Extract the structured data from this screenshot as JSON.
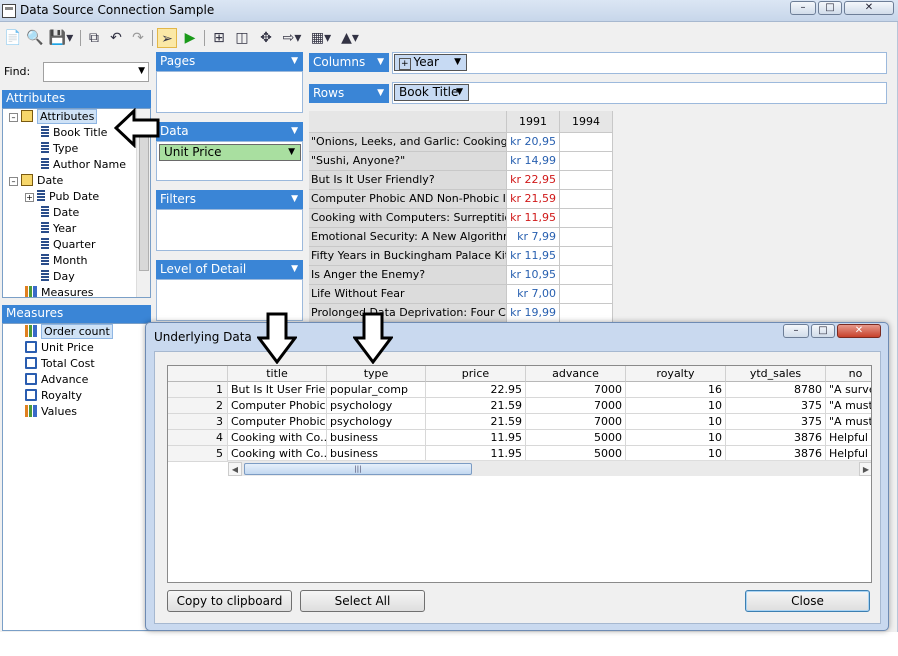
{
  "window": {
    "title": "Data Source Connection Sample",
    "controls": {
      "minimize": "–",
      "maximize": "□",
      "close": "✕"
    }
  },
  "toolbar": {
    "icons": [
      "new-icon",
      "preview-icon",
      "save-icon",
      "copy-icon",
      "undo-icon",
      "redo-icon",
      "pivot-icon",
      "run-icon",
      "table-icon",
      "column-icon",
      "move-icon",
      "export-icon",
      "layout-icon",
      "chart-icon"
    ]
  },
  "find": {
    "label": "Find:",
    "value": ""
  },
  "attributes_panel": {
    "header": "Attributes",
    "items": [
      {
        "label": "Attributes",
        "icon": "folder"
      },
      {
        "label": "Book Title",
        "icon": "attribute"
      },
      {
        "label": "Type",
        "icon": "attribute"
      },
      {
        "label": "Author Name",
        "icon": "attribute"
      },
      {
        "label": "Date",
        "icon": "folder"
      },
      {
        "label": "Pub Date",
        "icon": "hierarchy"
      },
      {
        "label": "Date",
        "icon": "attribute"
      },
      {
        "label": "Year",
        "icon": "attribute"
      },
      {
        "label": "Quarter",
        "icon": "attribute"
      },
      {
        "label": "Month",
        "icon": "attribute"
      },
      {
        "label": "Day",
        "icon": "attribute"
      },
      {
        "label": "Measures",
        "icon": "measure-group"
      }
    ]
  },
  "measures_panel": {
    "header": "Measures",
    "items": [
      {
        "label": "Order count",
        "icon": "measure-group"
      },
      {
        "label": "Unit Price",
        "icon": "measure"
      },
      {
        "label": "Total Cost",
        "icon": "measure"
      },
      {
        "label": "Advance",
        "icon": "measure"
      },
      {
        "label": "Royalty",
        "icon": "measure"
      },
      {
        "label": "Values",
        "icon": "measure-group"
      }
    ]
  },
  "shelves": {
    "pages": "Pages",
    "data": "Data",
    "data_field": "Unit Price",
    "filters": "Filters",
    "level_of_detail": "Level of Detail",
    "columns": "Columns",
    "columns_field": "Year",
    "rows": "Rows",
    "rows_field": "Book Title"
  },
  "pivot": {
    "columns": [
      "1991",
      "1994"
    ],
    "rows": [
      {
        "title": "\"Onions, Leeks, and Garlic: Cooking...",
        "v1991": "kr 20,95",
        "color": "#2860b0"
      },
      {
        "title": "\"Sushi, Anyone?\"",
        "v1991": "kr 14,99",
        "color": "#2860b0"
      },
      {
        "title": "But Is It User Friendly?",
        "v1991": "kr 22,95",
        "color": "#d01818"
      },
      {
        "title": "Computer Phobic AND Non-Phobic In...",
        "v1991": "kr 21,59",
        "color": "#d01818"
      },
      {
        "title": "Cooking with Computers: Surreptitiou...",
        "v1991": "kr 11,95",
        "color": "#d01818"
      },
      {
        "title": "Emotional Security: A New Algorithm",
        "v1991": "kr 7,99",
        "color": "#2860b0"
      },
      {
        "title": "Fifty Years in Buckingham Palace Kitc...",
        "v1991": "kr 11,95",
        "color": "#2860b0"
      },
      {
        "title": "Is Anger the Enemy?",
        "v1991": "kr 10,95",
        "color": "#2860b0"
      },
      {
        "title": "Life Without Fear",
        "v1991": "kr 7,00",
        "color": "#2860b0"
      },
      {
        "title": "Prolonged Data Deprivation: Four Cas...",
        "v1991": "kr 19,99",
        "color": "#2860b0"
      }
    ]
  },
  "dialog": {
    "title": "Underlying Data",
    "columns": [
      "title",
      "type",
      "price",
      "advance",
      "royalty",
      "ytd_sales",
      "no"
    ],
    "rows": [
      {
        "n": "1",
        "title": "But Is It User Frie...",
        "type": "popular_comp",
        "price": "22.95",
        "advance": "7000",
        "royalty": "16",
        "ytd_sales": "8780",
        "notes": "\"A surve"
      },
      {
        "n": "2",
        "title": "Computer Phobic...",
        "type": "psychology",
        "price": "21.59",
        "advance": "7000",
        "royalty": "10",
        "ytd_sales": "375",
        "notes": "\"A must"
      },
      {
        "n": "3",
        "title": "Computer Phobic...",
        "type": "psychology",
        "price": "21.59",
        "advance": "7000",
        "royalty": "10",
        "ytd_sales": "375",
        "notes": "\"A must"
      },
      {
        "n": "4",
        "title": "Cooking with Co...",
        "type": "business",
        "price": "11.95",
        "advance": "5000",
        "royalty": "10",
        "ytd_sales": "3876",
        "notes": "Helpful I"
      },
      {
        "n": "5",
        "title": "Cooking with Co...",
        "type": "business",
        "price": "11.95",
        "advance": "5000",
        "royalty": "10",
        "ytd_sales": "3876",
        "notes": "Helpful I"
      }
    ],
    "buttons": {
      "copy": "Copy to clipboard",
      "select_all": "Select All",
      "close": "Close"
    }
  }
}
